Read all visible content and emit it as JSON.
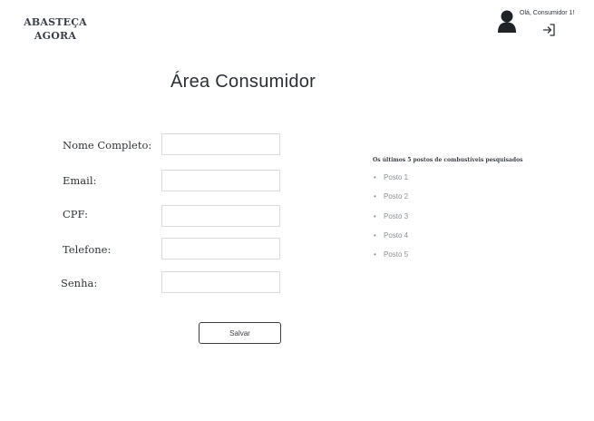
{
  "header": {
    "brand_line1": "ABASTEÇA",
    "brand_line2": "AGORA",
    "greeting": "Olá, Consumidor 1!",
    "icons": {
      "avatar": "user-avatar-icon",
      "logout": "logout-icon"
    }
  },
  "page": {
    "title": "Área Consumidor"
  },
  "form": {
    "name_label": "Nome Completo:",
    "email_label": "Email:",
    "cpf_label": "CPF:",
    "phone_label": "Telefone:",
    "password_label": "Senha:",
    "name_value": "",
    "email_value": "",
    "cpf_value": "",
    "phone_value": "",
    "password_value": "",
    "save_label": "Salvar"
  },
  "recent": {
    "title": "Os últimos 5 postos de combustíveis pesquisados",
    "items": [
      "Posto 1",
      "Posto 2",
      "Posto 3",
      "Posto 4",
      "Posto 5"
    ]
  }
}
